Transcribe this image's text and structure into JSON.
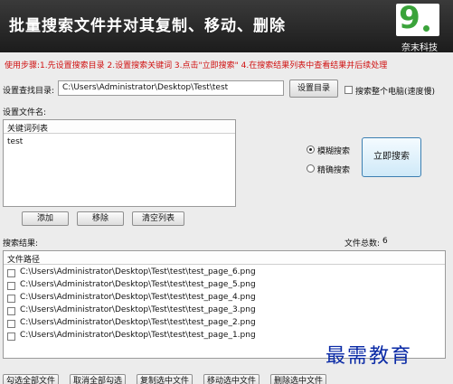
{
  "header": {
    "title": "批量搜索文件并对其复制、移动、删除",
    "logo_mark": "9.",
    "logo_text": "奈末科技"
  },
  "instructions": "使用步骤:1.先设置搜索目录 2.设置搜索关键词 3.点击\"立即搜索\" 4.在搜索结果列表中查看结果并后续处理",
  "search_dir": {
    "label": "设置查找目录:",
    "value": "C:\\Users\\Administrator\\Desktop\\Test\\test",
    "button": "设置目录",
    "whole_pc_label": "搜索整个电脑(速度慢)",
    "whole_pc_checked": false
  },
  "filename": {
    "label": "设置文件名:",
    "list_header": "关键词列表",
    "items": [
      "test"
    ],
    "add_button": "添加",
    "remove_button": "移除",
    "clear_button": "清空列表"
  },
  "search_mode": {
    "fuzzy_label": "模糊搜索",
    "exact_label": "精确搜索",
    "selected": "fuzzy",
    "search_button": "立即搜索"
  },
  "results": {
    "label": "搜索结果:",
    "count_label": "文件总数:",
    "count": "6",
    "column_header": "文件路径",
    "rows": [
      "C:\\Users\\Administrator\\Desktop\\Test\\test\\test_page_6.png",
      "C:\\Users\\Administrator\\Desktop\\Test\\test\\test_page_5.png",
      "C:\\Users\\Administrator\\Desktop\\Test\\test\\test_page_4.png",
      "C:\\Users\\Administrator\\Desktop\\Test\\test\\test_page_3.png",
      "C:\\Users\\Administrator\\Desktop\\Test\\test\\test_page_2.png",
      "C:\\Users\\Administrator\\Desktop\\Test\\test\\test_page_1.png"
    ]
  },
  "bottom_buttons": {
    "select_all": "勾选全部文件",
    "unselect_all": "取消全部勾选",
    "copy": "复制选中文件",
    "move": "移动选中文件",
    "delete": "删除选中文件"
  },
  "watermark": "最需教育",
  "colors": {
    "header_bg": "#2a2a2a",
    "instructions": "#d01010",
    "logo_green": "#3aa33a",
    "search_button_border": "#3c7fb1",
    "watermark": "#0a2aa6"
  }
}
